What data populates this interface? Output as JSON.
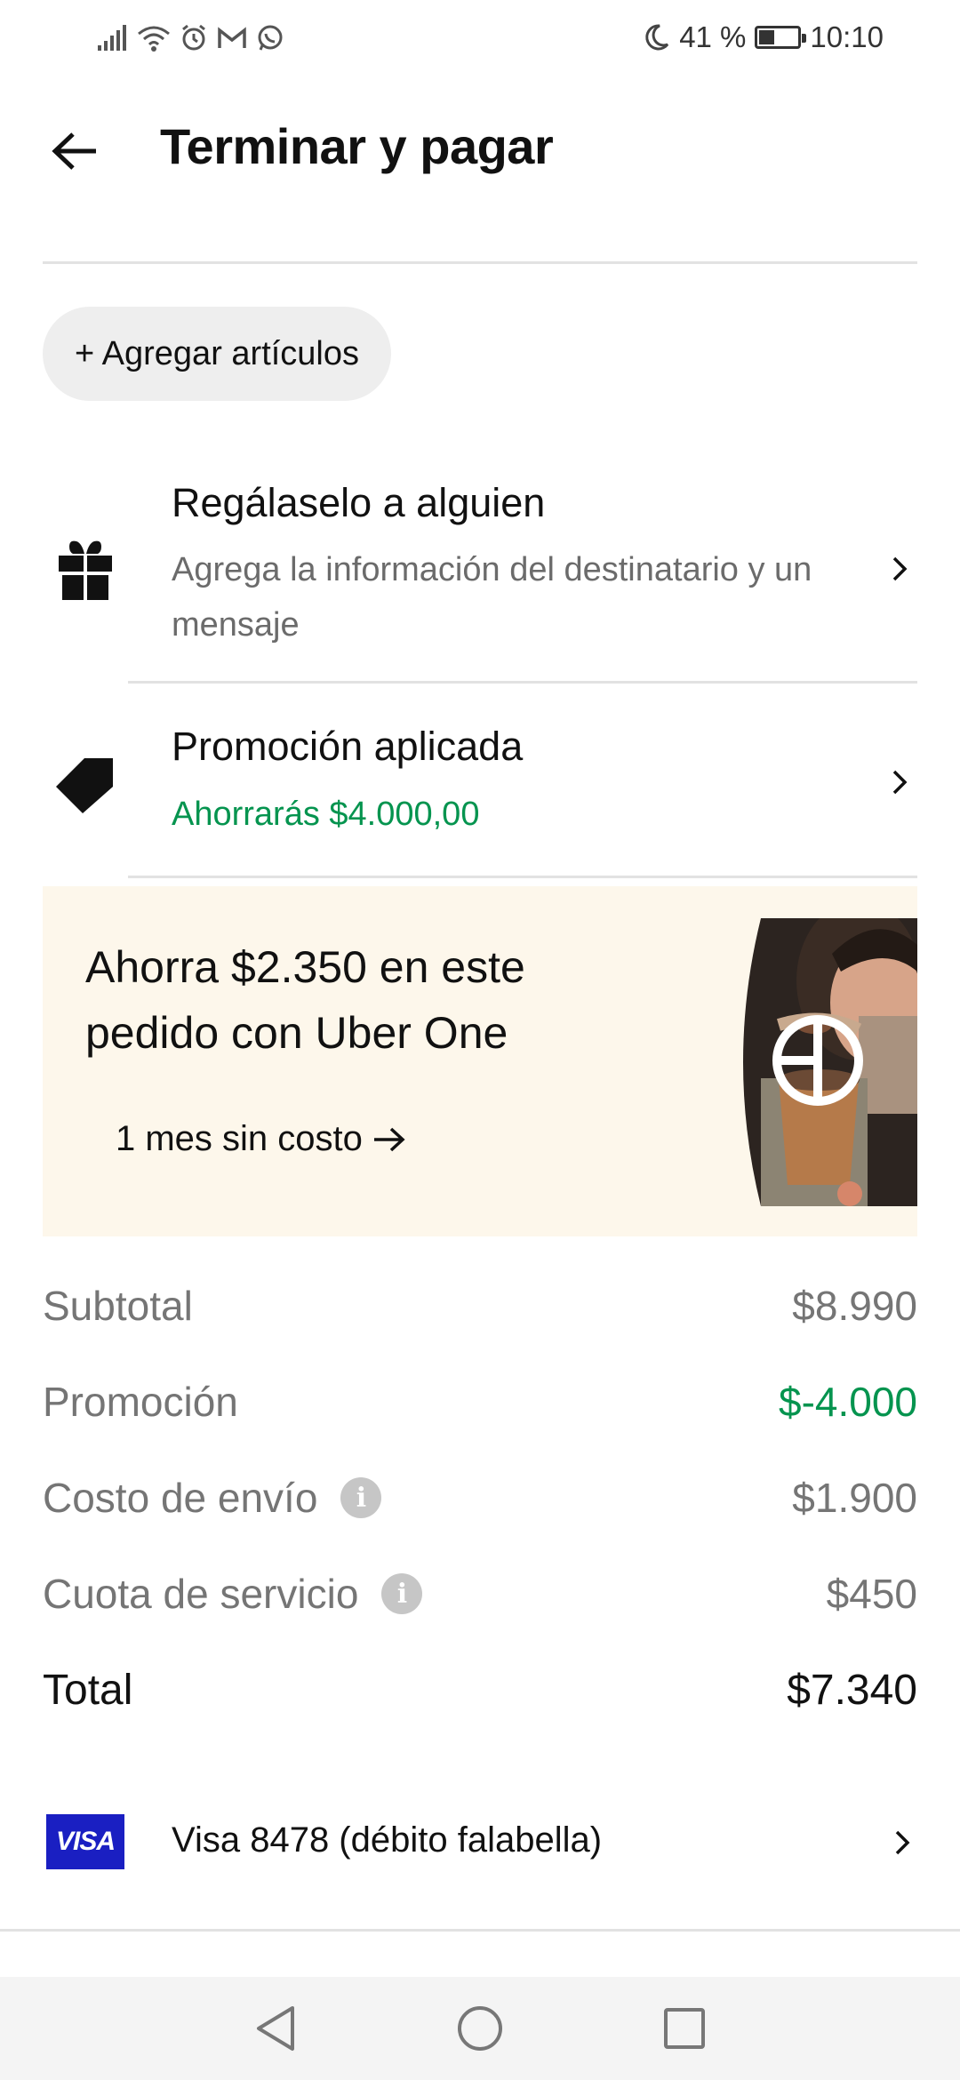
{
  "status_bar": {
    "battery_text": "41 %",
    "battery_level": 0.41,
    "time": "10:10"
  },
  "header": {
    "title": "Terminar y pagar"
  },
  "add_items_label": "+ Agregar artículos",
  "gift": {
    "title": "Regálaselo a alguien",
    "subtitle": "Agrega la información del destinatario y un mensaje"
  },
  "promotion": {
    "title": "Promoción aplicada",
    "subtitle": "Ahorrarás $4.000,00"
  },
  "uber_one": {
    "headline": "Ahorra $2.350 en este pedido con Uber One",
    "cta": "1 mes sin costo"
  },
  "summary": {
    "subtotal_label": "Subtotal",
    "subtotal_value": "$8.990",
    "promo_label": "Promoción",
    "promo_value": "$-4.000",
    "delivery_label": "Costo de envío",
    "delivery_value": "$1.900",
    "service_label": "Cuota de servicio",
    "service_value": "$450",
    "total_label": "Total",
    "total_value": "$7.340"
  },
  "payment": {
    "brand": "VISA",
    "label": "Visa 8478 (débito falabella)"
  },
  "colors": {
    "accent_green": "#05944f",
    "banner_bg": "#fdf7eb",
    "visa_blue": "#1a1fc2"
  }
}
